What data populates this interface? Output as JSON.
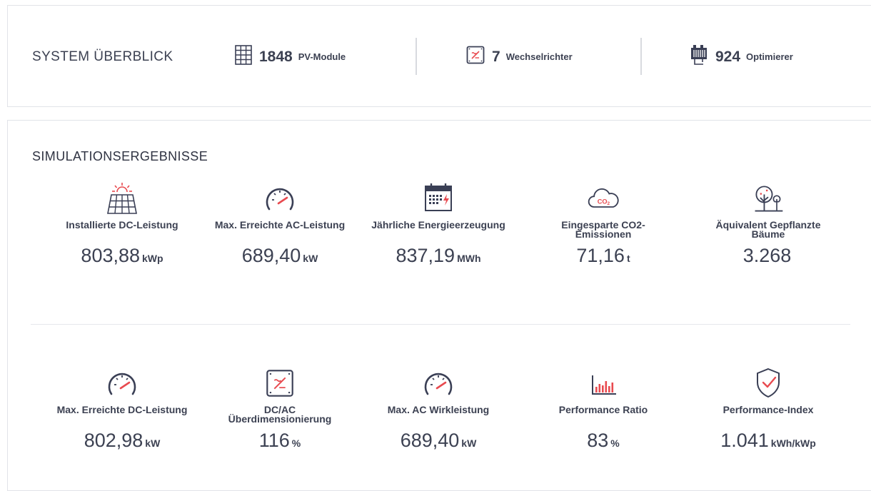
{
  "overview": {
    "title": "SYSTEM ÜBERBLICK",
    "stats": [
      {
        "icon": "pv-module-icon",
        "value": "1848",
        "label": "PV-Module"
      },
      {
        "icon": "inverter-icon",
        "value": "7",
        "label": "Wechselrichter"
      },
      {
        "icon": "optimizer-icon",
        "value": "924",
        "label": "Optimierer"
      }
    ]
  },
  "results": {
    "title": "SIMULATIONSERGEBNISSE",
    "row1": [
      {
        "icon": "solar-panel-sun-icon",
        "label": "Installierte DC-Leistung",
        "value": "803,88",
        "unit": "kWp"
      },
      {
        "icon": "gauge-icon",
        "label": "Max. Erreichte AC-Leistung",
        "value": "689,40",
        "unit": "kW"
      },
      {
        "icon": "calendar-energy-icon",
        "label": "Jährliche Energieerzeugung",
        "value": "837,19",
        "unit": "MWh"
      },
      {
        "icon": "co2-cloud-icon",
        "label": "Eingesparte CO2-Emissionen",
        "value": "71,16",
        "unit": "t"
      },
      {
        "icon": "trees-icon",
        "label": "Äquivalent Gepflanzte Bäume",
        "value": "3.268",
        "unit": ""
      }
    ],
    "row2": [
      {
        "icon": "gauge-icon",
        "label": "Max. Erreichte DC-Leistung",
        "value": "802,98",
        "unit": "kW"
      },
      {
        "icon": "inverter-icon",
        "label": "DC/AC Überdimensionierung",
        "value": "116",
        "unit": "%"
      },
      {
        "icon": "gauge-icon",
        "label": "Max. AC Wirkleistung",
        "value": "689,40",
        "unit": "kW"
      },
      {
        "icon": "bar-chart-icon",
        "label": "Performance Ratio",
        "value": "83",
        "unit": "%"
      },
      {
        "icon": "shield-check-icon",
        "label": "Performance-Index",
        "value": "1.041",
        "unit": "kWh/kWp"
      }
    ]
  },
  "colors": {
    "text": "#3c4152",
    "icon_dark": "#3a3f55",
    "accent_red": "#e84a4f",
    "border": "#e1e3e8"
  }
}
